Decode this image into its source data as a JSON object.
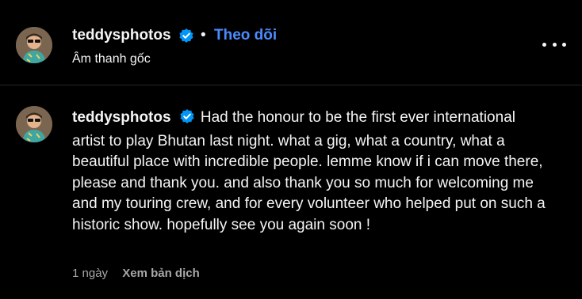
{
  "header": {
    "username": "teddysphotos",
    "verified_icon": "verified-badge-icon",
    "separator": "•",
    "follow_label": "Theo dõi",
    "audio_label": "Âm thanh gốc",
    "more_icon": "more-options-icon"
  },
  "comment": {
    "username": "teddysphotos",
    "text": "Had the honour to be the first ever international artist to play Bhutan last night. what a gig, what a country, what a beautiful place with incredible people. lemme know if i can move there, please and thank you. and also thank you so much for welcoming me and my touring crew, and for every volunteer who helped put on such a historic show. hopefully see you again soon !",
    "time": "1 ngày",
    "translate_label": "Xem bản dịch"
  },
  "colors": {
    "background": "#000000",
    "accent": "#4a8cff",
    "verified": "#0095f6",
    "muted": "#a8a8a8"
  }
}
